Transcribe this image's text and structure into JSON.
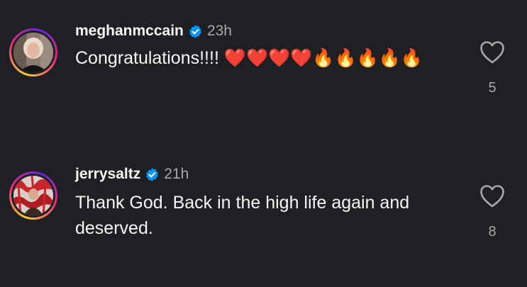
{
  "comments": [
    {
      "username": "meghanmccain",
      "timestamp": "23h",
      "text": "Congratulations!!!! ❤️❤️❤️❤️🔥🔥🔥🔥🔥",
      "likes": "5",
      "verified": true
    },
    {
      "username": "jerrysaltz",
      "timestamp": "21h",
      "text": "Thank God.  Back in the high life again and deserved.",
      "likes": "8",
      "verified": true
    }
  ],
  "colors": {
    "background": "#1f2024",
    "verified_badge": "#0095f6",
    "muted_text": "#a8a8a8",
    "primary_text": "#f5f5f5"
  },
  "icons": {
    "like": "heart-outline-icon",
    "verified": "verified-badge-icon"
  }
}
